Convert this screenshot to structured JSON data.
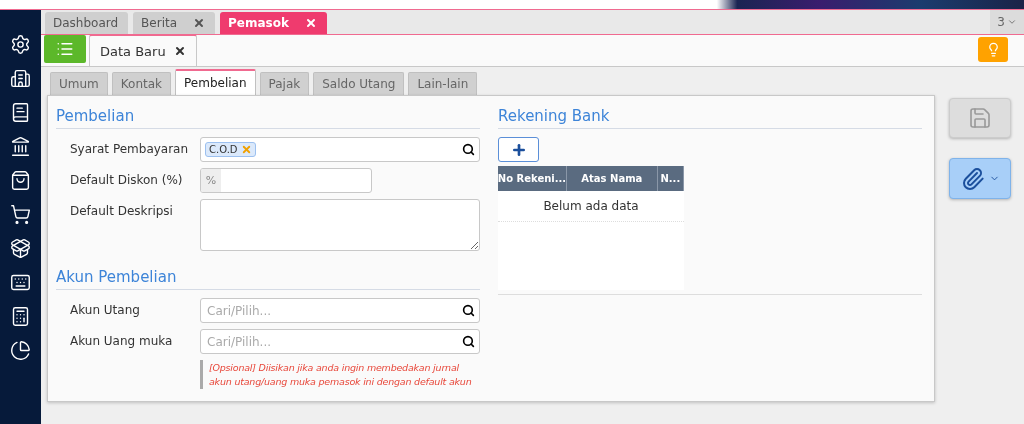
{
  "top_tabs": [
    {
      "label": "Dashboard",
      "closable": false,
      "selected": false
    },
    {
      "label": "Berita",
      "closable": true,
      "selected": false
    },
    {
      "label": "Pemasok",
      "closable": true,
      "selected": true
    }
  ],
  "tab_counter": "3",
  "doc_tabs": [
    {
      "label": "Data Baru",
      "selected": true
    }
  ],
  "section_tabs": [
    {
      "label": "Umum",
      "selected": false
    },
    {
      "label": "Kontak",
      "selected": false
    },
    {
      "label": "Pembelian",
      "selected": true
    },
    {
      "label": "Pajak",
      "selected": false
    },
    {
      "label": "Saldo Utang",
      "selected": false
    },
    {
      "label": "Lain-lain",
      "selected": false
    }
  ],
  "purchase": {
    "title": "Pembelian",
    "fields": [
      {
        "kind": "tags",
        "label": "Syarat Pembayaran",
        "tags": [
          "C.O.D"
        ]
      },
      {
        "kind": "addon",
        "label": "Default Diskon (%)",
        "addon": "%"
      },
      {
        "kind": "textarea",
        "label": "Default Deskripsi"
      }
    ]
  },
  "accounts": {
    "title": "Akun Pembelian",
    "fields": [
      {
        "kind": "search",
        "label": "Akun Utang",
        "placeholder": "Cari/Pilih..."
      },
      {
        "kind": "search",
        "label": "Akun Uang muka",
        "placeholder": "Cari/Pilih..."
      }
    ],
    "hint": "[Opsional] Diisikan jika anda ingin membedakan jurnal akun utang/uang muka pemasok ini dengan default akun"
  },
  "bank": {
    "title": "Rekening Bank",
    "columns": [
      "No Rekeni...",
      "Atas Nama",
      "N..."
    ],
    "empty": "Belum ada data"
  },
  "save_disabled": true
}
